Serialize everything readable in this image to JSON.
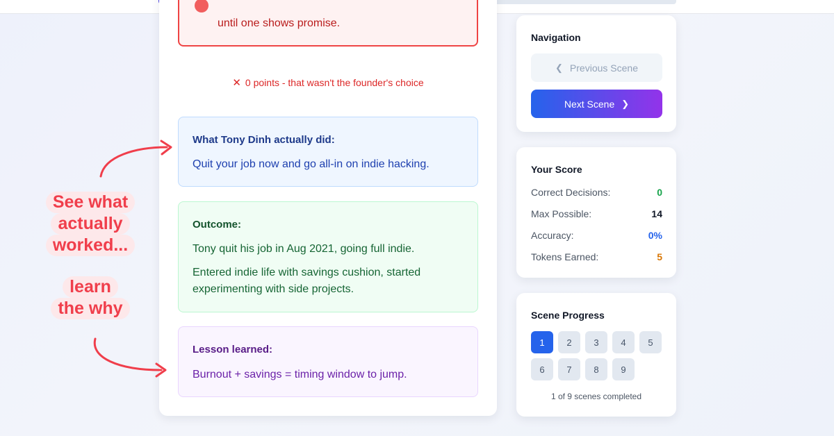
{
  "progress": {
    "fraction": 0.11
  },
  "main": {
    "choice_text": "until one shows promise.",
    "points_text": "0 points - that wasn't the founder's choice",
    "did": {
      "title": "What Tony Dinh actually did:",
      "body": "Quit your job now and go all-in on indie hacking."
    },
    "outcome": {
      "title": "Outcome:",
      "line1": "Tony quit his job in Aug 2021, going full indie.",
      "line2": "Entered indie life with savings cushion, started experimenting with side projects."
    },
    "lesson": {
      "title": "Lesson learned:",
      "body": "Burnout + savings = timing window to jump."
    }
  },
  "navigation": {
    "title": "Navigation",
    "prev_label": "Previous Scene",
    "next_label": "Next Scene"
  },
  "score": {
    "title": "Your Score",
    "rows": [
      {
        "label": "Correct Decisions:",
        "value": "0"
      },
      {
        "label": "Max Possible:",
        "value": "14"
      },
      {
        "label": "Accuracy:",
        "value": "0%"
      },
      {
        "label": "Tokens Earned:",
        "value": "5"
      }
    ]
  },
  "scene_progress": {
    "title": "Scene Progress",
    "scenes": [
      "1",
      "2",
      "3",
      "4",
      "5",
      "6",
      "7",
      "8",
      "9"
    ],
    "active": "1",
    "status": "1 of 9 scenes completed"
  },
  "annotations": {
    "first": [
      "See what",
      "actually",
      "worked..."
    ],
    "second": [
      "learn",
      "the why"
    ]
  },
  "colors": {
    "accent_red": "#f03e4b",
    "primary_blue": "#2563eb",
    "primary_purple": "#9333ea"
  }
}
